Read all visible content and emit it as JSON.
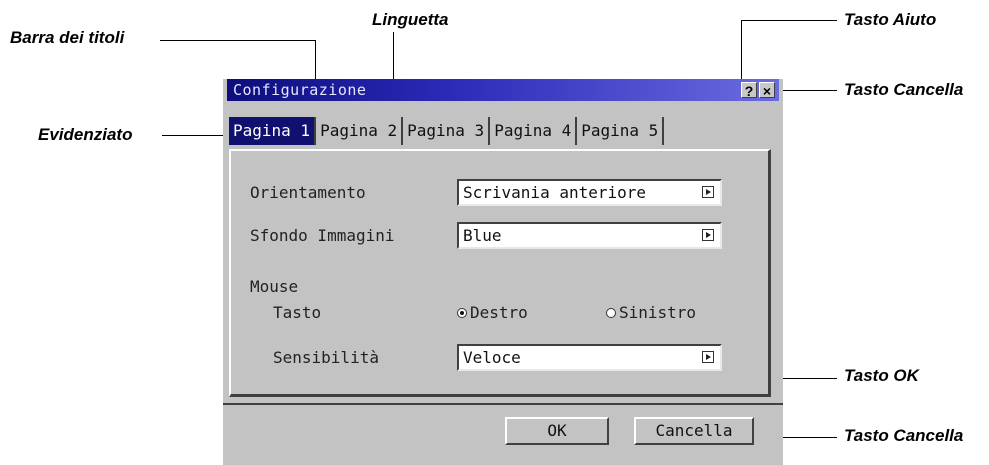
{
  "callouts": {
    "title_bar": "Barra dei titoli",
    "tab": "Linguetta",
    "highlight": "Evidenziato",
    "help_key": "Tasto Aiuto",
    "cancel_key_top": "Tasto Cancella",
    "ok_key": "Tasto OK",
    "cancel_key_bottom": "Tasto Cancella"
  },
  "dialog": {
    "title": "Configurazione",
    "help_button": "?",
    "close_button": "×",
    "tabs": [
      {
        "label": "Pagina 1",
        "active": true
      },
      {
        "label": "Pagina 2"
      },
      {
        "label": "Pagina 3"
      },
      {
        "label": "Pagina 4"
      },
      {
        "label": "Pagina 5"
      }
    ],
    "orientation": {
      "label": "Orientamento",
      "value": "Scrivania anteriore"
    },
    "background": {
      "label": "Sfondo Immagini",
      "value": "Blue"
    },
    "mouse": {
      "label": "Mouse",
      "button_label": "Tasto",
      "options": [
        {
          "label": "Destro",
          "selected": true
        },
        {
          "label": "Sinistro",
          "selected": false
        }
      ],
      "sensitivity": {
        "label": "Sensibilità",
        "value": "Veloce"
      }
    },
    "ok_button": "OK",
    "cancel_button": "Cancella"
  }
}
